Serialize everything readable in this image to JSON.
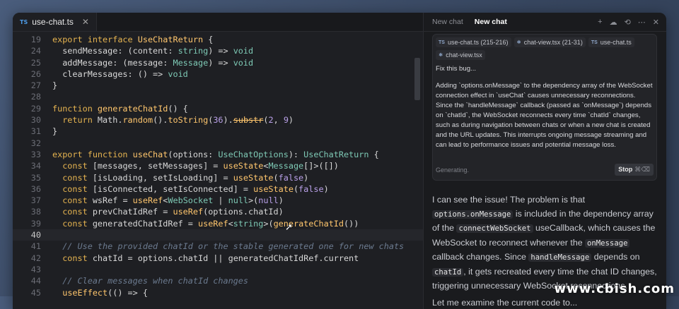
{
  "editor": {
    "tab": {
      "label": "use-chat.ts",
      "file_type_badge": "TS"
    },
    "lines": [
      {
        "n": "19",
        "tokens": [
          [
            "k",
            "export "
          ],
          [
            "k",
            "interface "
          ],
          [
            "f",
            "UseChatReturn"
          ],
          [
            "txt",
            " {"
          ]
        ]
      },
      {
        "n": "24",
        "tokens": [
          [
            "txt",
            "  sendMessage: ("
          ],
          [
            "txt",
            "content: "
          ],
          [
            "t",
            "string"
          ],
          [
            "txt",
            ") => "
          ],
          [
            "t",
            "void"
          ]
        ]
      },
      {
        "n": "25",
        "tokens": [
          [
            "txt",
            "  addMessage: ("
          ],
          [
            "txt",
            "message: "
          ],
          [
            "t",
            "Message"
          ],
          [
            "txt",
            ") => "
          ],
          [
            "t",
            "void"
          ]
        ]
      },
      {
        "n": "26",
        "tokens": [
          [
            "txt",
            "  clearMessages: () => "
          ],
          [
            "t",
            "void"
          ]
        ]
      },
      {
        "n": "27",
        "tokens": [
          [
            "txt",
            "}"
          ]
        ]
      },
      {
        "n": "28",
        "tokens": []
      },
      {
        "n": "29",
        "tokens": [
          [
            "k",
            "function "
          ],
          [
            "f",
            "generateChatId"
          ],
          [
            "txt",
            "() {"
          ]
        ]
      },
      {
        "n": "30",
        "tokens": [
          [
            "k",
            "  return "
          ],
          [
            "txt",
            "Math."
          ],
          [
            "f",
            "random"
          ],
          [
            "txt",
            "()."
          ],
          [
            "f",
            "toString"
          ],
          [
            "txt",
            "("
          ],
          [
            "p",
            "36"
          ],
          [
            "txt",
            ")."
          ],
          [
            "strike",
            "substr"
          ],
          [
            "txt",
            "("
          ],
          [
            "p",
            "2"
          ],
          [
            "txt",
            ", "
          ],
          [
            "p",
            "9"
          ],
          [
            "txt",
            ")"
          ]
        ]
      },
      {
        "n": "31",
        "tokens": [
          [
            "txt",
            "}"
          ]
        ]
      },
      {
        "n": "32",
        "tokens": []
      },
      {
        "n": "33",
        "tokens": [
          [
            "k",
            "export "
          ],
          [
            "k",
            "function "
          ],
          [
            "f",
            "useChat"
          ],
          [
            "txt",
            "(options: "
          ],
          [
            "t",
            "UseChatOptions"
          ],
          [
            "txt",
            "): "
          ],
          [
            "t",
            "UseChatReturn"
          ],
          [
            "txt",
            " {"
          ]
        ]
      },
      {
        "n": "34",
        "tokens": [
          [
            "k",
            "  const "
          ],
          [
            "txt",
            "[messages, setMessages] = "
          ],
          [
            "f",
            "useState"
          ],
          [
            "txt",
            "<"
          ],
          [
            "t",
            "Message"
          ],
          [
            "txt",
            "[]>([])"
          ]
        ]
      },
      {
        "n": "35",
        "tokens": [
          [
            "k",
            "  const "
          ],
          [
            "txt",
            "[isLoading, setIsLoading] = "
          ],
          [
            "f",
            "useState"
          ],
          [
            "txt",
            "("
          ],
          [
            "p",
            "false"
          ],
          [
            "txt",
            ")"
          ]
        ]
      },
      {
        "n": "36",
        "tokens": [
          [
            "k",
            "  const "
          ],
          [
            "txt",
            "[isConnected, setIsConnected] = "
          ],
          [
            "f",
            "useState"
          ],
          [
            "txt",
            "("
          ],
          [
            "p",
            "false"
          ],
          [
            "txt",
            ")"
          ]
        ]
      },
      {
        "n": "37",
        "tokens": [
          [
            "k",
            "  const "
          ],
          [
            "txt",
            "wsRef = "
          ],
          [
            "f",
            "useRef"
          ],
          [
            "txt",
            "<"
          ],
          [
            "t",
            "WebSocket"
          ],
          [
            "txt",
            " | "
          ],
          [
            "t",
            "null"
          ],
          [
            "txt",
            ">("
          ],
          [
            "p",
            "null"
          ],
          [
            "txt",
            ")"
          ]
        ]
      },
      {
        "n": "38",
        "tokens": [
          [
            "k",
            "  const "
          ],
          [
            "txt",
            "prevChatIdRef = "
          ],
          [
            "f",
            "useRef"
          ],
          [
            "txt",
            "(options.chatId)"
          ]
        ]
      },
      {
        "n": "39",
        "tokens": [
          [
            "k",
            "  const "
          ],
          [
            "txt",
            "generatedChatIdRef = "
          ],
          [
            "f",
            "useRef"
          ],
          [
            "txt",
            "<"
          ],
          [
            "t",
            "string"
          ],
          [
            "txt",
            ">("
          ],
          [
            "f",
            "generateChatId"
          ],
          [
            "txt",
            "())"
          ]
        ]
      },
      {
        "n": "40",
        "tokens": [],
        "current": true
      },
      {
        "n": "41",
        "tokens": [
          [
            "c",
            "  // Use the provided chatId or the stable generated one for new chats"
          ]
        ]
      },
      {
        "n": "42",
        "tokens": [
          [
            "k",
            "  const "
          ],
          [
            "txt",
            "chatId = options.chatId || generatedChatIdRef.current"
          ]
        ]
      },
      {
        "n": "43",
        "tokens": []
      },
      {
        "n": "44",
        "tokens": [
          [
            "c",
            "  // Clear messages when chatId changes"
          ]
        ]
      },
      {
        "n": "45",
        "tokens": [
          [
            "txt",
            "  "
          ],
          [
            "f",
            "useEffect"
          ],
          [
            "txt",
            "(() => {"
          ]
        ]
      }
    ]
  },
  "chat": {
    "tabs": [
      "New chat",
      "New chat"
    ],
    "active_tab": 1,
    "actions": [
      {
        "name": "new-chat-icon",
        "glyph": "+"
      },
      {
        "name": "cloud-icon",
        "glyph": "☁"
      },
      {
        "name": "history-icon",
        "glyph": "⟲"
      },
      {
        "name": "more-icon",
        "glyph": "⋯"
      },
      {
        "name": "close-icon",
        "glyph": "✕"
      }
    ],
    "context_chips": [
      {
        "badge": "TS",
        "label": "use-chat.ts (215-216)"
      },
      {
        "badge": "⚛",
        "label": "chat-view.tsx (21-31)"
      },
      {
        "badge": "TS",
        "label": "use-chat.ts"
      },
      {
        "badge": "⚛",
        "label": "chat-view.tsx"
      }
    ],
    "prompt_p1": "Fix this bug...",
    "prompt_p2": "Adding `options.onMessage` to the dependency array of the WebSocket connection effect in `useChat` causes unnecessary reconnections. Since the `handleMessage` callback (passed as `onMessage`) depends on `chatId`, the WebSocket reconnects every time `chatId` changes, such as during navigation between chats or when a new chat is created and the URL updates. This interrupts ongoing message streaming and can lead to performance issues and potential message loss.",
    "status": "Generating.",
    "stop_label": "Stop",
    "stop_shortcut": "⌘⌫",
    "answer": {
      "t1": "I can see the issue! The problem is that ",
      "c1": "options.onMessage",
      "t2": " is included in the dependency array of the ",
      "c2": "connectWebSocket",
      "t3": " useCallback, which causes the WebSocket to reconnect whenever the ",
      "c3": "onMessage",
      "t4": " callback changes. Since ",
      "c4": "handleMessage",
      "t5": " depends on ",
      "c5": "chatId",
      "t6": ", it gets recreated every time the chat ID changes, triggering unnecessary WebSocket reconnections.",
      "t7": "Let me examine the current code to..."
    }
  },
  "watermark": "www.cbish.com"
}
